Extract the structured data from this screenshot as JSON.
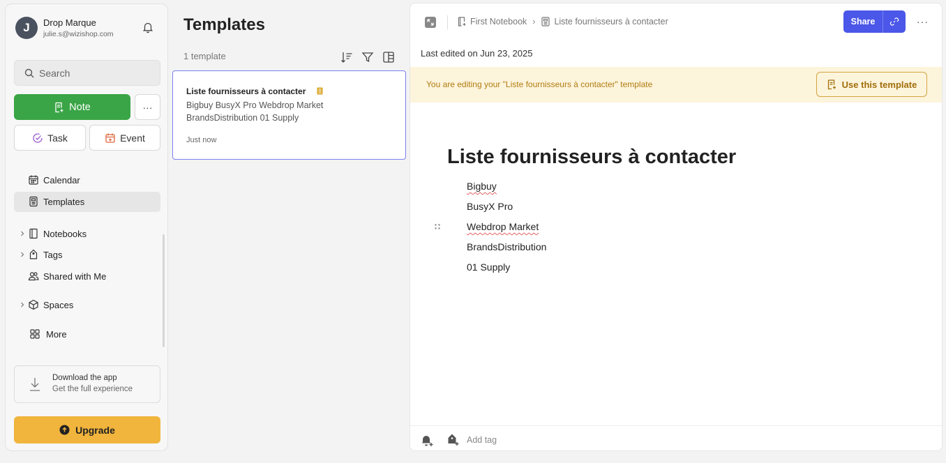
{
  "account": {
    "initial": "J",
    "name": "Drop Marque",
    "email": "julie.s@wizishop.com"
  },
  "search": {
    "placeholder": "Search"
  },
  "create": {
    "note_label": "Note",
    "more_label": "···",
    "task_label": "Task",
    "event_label": "Event"
  },
  "nav": {
    "calendar": "Calendar",
    "templates": "Templates",
    "notebooks": "Notebooks",
    "tags": "Tags",
    "shared": "Shared with Me",
    "spaces": "Spaces",
    "more": "More"
  },
  "download": {
    "title": "Download the app",
    "subtitle": "Get the full experience"
  },
  "upgrade_label": "Upgrade",
  "list": {
    "title": "Templates",
    "count": "1 template",
    "card": {
      "title": "Liste fournisseurs à contacter",
      "preview": "Bigbuy BusyX Pro Webdrop Market BrandsDistribution 01 Supply",
      "time": "Just now"
    }
  },
  "editor": {
    "breadcrumb": {
      "notebook": "First Notebook",
      "note": "Liste fournisseurs à contacter"
    },
    "share_label": "Share",
    "more_label": "···",
    "last_edited": "Last edited on Jun 23, 2025",
    "banner_text": "You are editing your \"Liste fournisseurs à contacter\" template",
    "use_template_label": "Use this template",
    "title": "Liste fournisseurs à contacter",
    "lines": [
      "Bigbuy",
      "BusyX Pro",
      "Webdrop Market",
      "BrandsDistribution",
      "01 Supply"
    ],
    "add_tag_label": "Add tag"
  },
  "colors": {
    "note_green": "#3aa546",
    "share_blue": "#4b57e8",
    "upgrade_yellow": "#f1b43c",
    "banner_bg": "#fdf4dc",
    "banner_text": "#b07c10",
    "card_border": "#7c7ff0"
  },
  "icons": {
    "bell": "bell-icon",
    "search": "search-icon",
    "note": "note-plus-icon",
    "task": "check-circle-icon",
    "event": "calendar-plus-icon",
    "calendar": "calendar-icon",
    "templates": "template-icon",
    "notebooks": "notebook-icon",
    "tags": "tag-icon",
    "shared": "people-icon",
    "spaces": "cube-icon",
    "more": "grid-icon",
    "download": "download-icon",
    "upgrade": "arrow-up-circle-icon",
    "sort": "sort-icon",
    "filter": "filter-icon",
    "layout": "layout-icon",
    "expand": "expand-icon",
    "link": "link-icon"
  }
}
